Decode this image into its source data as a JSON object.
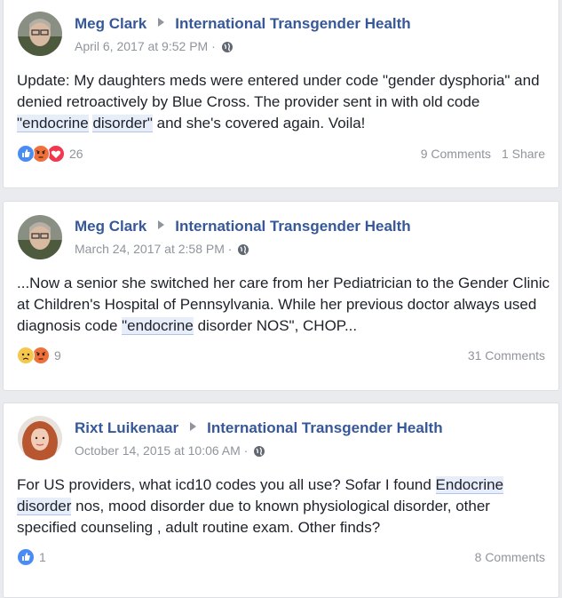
{
  "posts": [
    {
      "author": "Meg Clark",
      "group": "International Transgender Health",
      "timestamp": "April 6, 2017 at 9:52 PM",
      "privacy_icon": "globe-icon",
      "text_parts": [
        "Update: My daughters meds were entered under code \"gender dysphoria\" and denied retroactively by Blue Cross. The provider sent in with old code ",
        "\"endocrine",
        " ",
        "disorder\"",
        " and she's covered again. Voila!"
      ],
      "reactions": [
        "like-icon",
        "angry-icon",
        "love-icon"
      ],
      "reaction_count": "26",
      "comments": "9 Comments",
      "shares": "1 Share"
    },
    {
      "author": "Meg Clark",
      "group": "International Transgender Health",
      "timestamp": "March 24, 2017 at 2:58 PM",
      "privacy_icon": "globe-icon",
      "text_parts": [
        "...Now a senior she switched her care from her Pediatrician to the Gender Clinic at Children's Hospital of Pennsylvania. While her previous doctor always used diagnosis code ",
        "\"endocrine",
        " disorder NOS\", CHOP..."
      ],
      "reactions": [
        "sad-icon",
        "angry-icon"
      ],
      "reaction_count": "9",
      "comments": "31 Comments"
    },
    {
      "author": "Rixt Luikenaar",
      "group": "International Transgender Health",
      "timestamp": "October 14, 2015 at 10:06 AM",
      "privacy_icon": "globe-icon",
      "text_parts": [
        "For US providers, what icd10 codes you all use? Sofar I found ",
        "Endocrine",
        " ",
        "disorder",
        " nos, mood disorder due to known physiological disorder, other specified counseling , adult routine exam. Other finds?"
      ],
      "reactions": [
        "like-icon"
      ],
      "reaction_count": "1",
      "comments": "8 Comments"
    }
  ],
  "colors": {
    "link": "#365899",
    "meta": "#90949c",
    "text": "#1d2129",
    "highlight": "#e7eefa",
    "like": "#4a8cf6",
    "angry": "#f0703c",
    "love": "#f0384f",
    "sad": "#f5c74b"
  }
}
